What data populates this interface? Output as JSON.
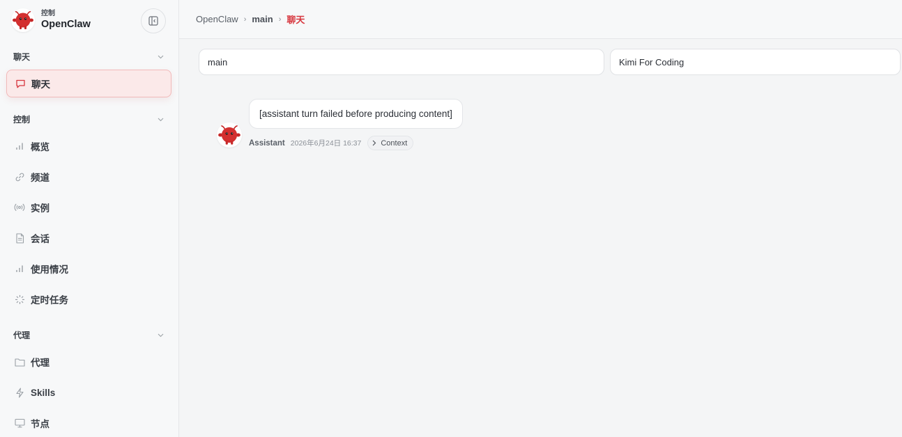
{
  "brand": {
    "subtitle": "控制",
    "title": "OpenClaw",
    "accent": "#d7373f"
  },
  "sidebar": {
    "sections": [
      {
        "label": "聊天",
        "items": [
          {
            "label": "聊天",
            "icon": "message-icon",
            "active": true
          }
        ]
      },
      {
        "label": "控制",
        "items": [
          {
            "label": "概览",
            "icon": "bar-chart-icon"
          },
          {
            "label": "频道",
            "icon": "link-icon"
          },
          {
            "label": "实例",
            "icon": "broadcast-icon"
          },
          {
            "label": "会话",
            "icon": "document-icon"
          },
          {
            "label": "使用情况",
            "icon": "bar-chart-icon"
          },
          {
            "label": "定时任务",
            "icon": "loader-icon"
          }
        ]
      },
      {
        "label": "代理",
        "items": [
          {
            "label": "代理",
            "icon": "folder-icon"
          },
          {
            "label": "Skills",
            "icon": "lightning-icon"
          },
          {
            "label": "节点",
            "icon": "monitor-icon"
          }
        ]
      }
    ]
  },
  "breadcrumb": {
    "root": "OpenClaw",
    "middle": "main",
    "current": "聊天"
  },
  "selectors": {
    "session": "main",
    "model": "Kimi For Coding"
  },
  "message": {
    "text": "[assistant turn failed before producing content]",
    "author": "Assistant",
    "time": "2026年6月24日 16:37",
    "context_label": "Context"
  }
}
